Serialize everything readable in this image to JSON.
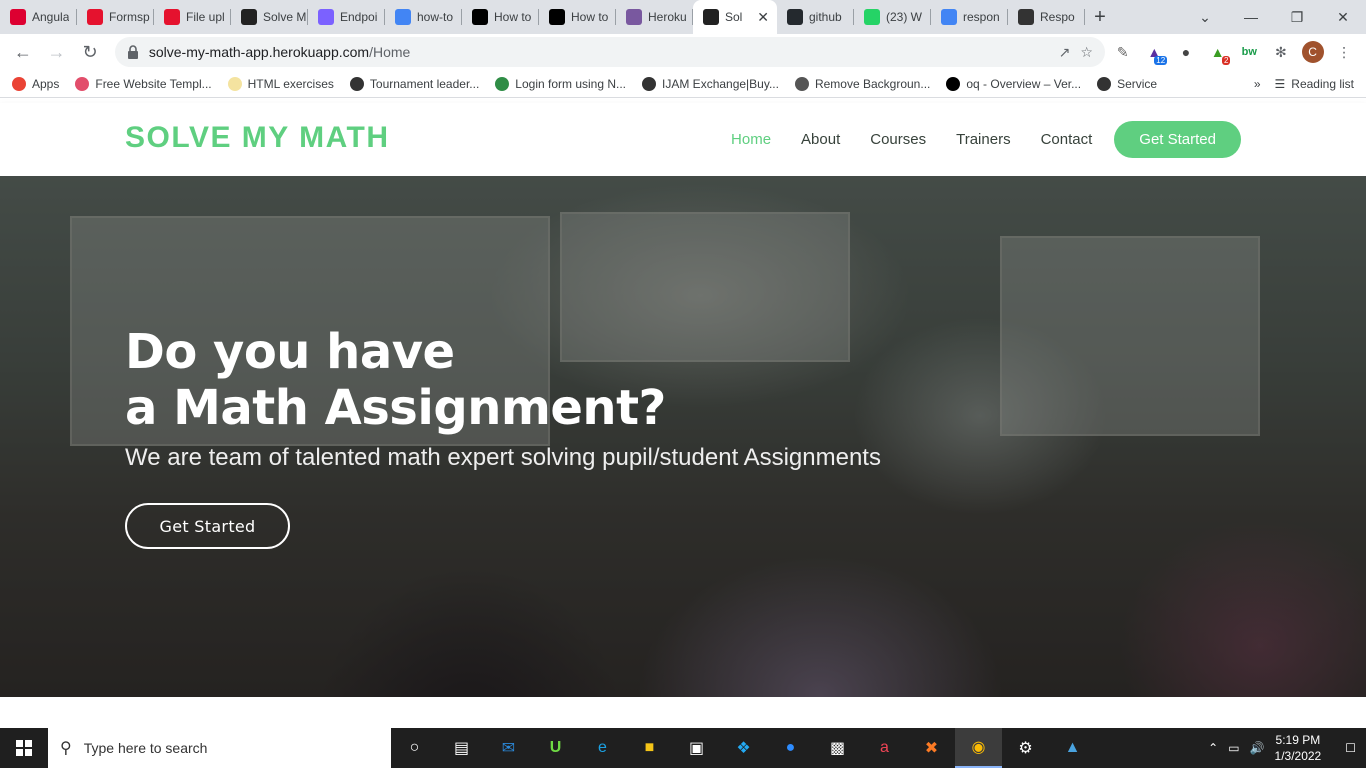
{
  "browser": {
    "tabs": [
      {
        "label": "Angula",
        "icon": "angular-icon",
        "color": "#dd0031"
      },
      {
        "label": "Formsp",
        "icon": "formspree-icon",
        "color": "#e5122e"
      },
      {
        "label": "File upl",
        "icon": "formspree-icon",
        "color": "#e5122e"
      },
      {
        "label": "Solve M",
        "icon": "angular-dark-icon",
        "color": "#222222"
      },
      {
        "label": "Endpoi",
        "icon": "endpoint-icon",
        "color": "#7b61ff"
      },
      {
        "label": "how-to",
        "icon": "google-icon",
        "color": "#4285f4"
      },
      {
        "label": "How to",
        "icon": "medium-icon",
        "color": "#000000"
      },
      {
        "label": "How to",
        "icon": "medium-icon",
        "color": "#000000"
      },
      {
        "label": "Heroku",
        "icon": "heroku-icon",
        "color": "#79589f"
      },
      {
        "label": "Sol",
        "icon": "angular-dark-icon",
        "color": "#222222",
        "active": true
      },
      {
        "label": "github",
        "icon": "github-icon",
        "color": "#24292e"
      },
      {
        "label": "(23) W",
        "icon": "whatsapp-icon",
        "color": "#25d366"
      },
      {
        "label": "respon",
        "icon": "google-icon",
        "color": "#4285f4"
      },
      {
        "label": "Respo",
        "icon": "responsive-icon",
        "color": "#333333"
      }
    ],
    "url_host": "solve-my-math-app.herokuapp.com",
    "url_path": "/Home",
    "profile_initial": "C",
    "ext_badge_1": "12",
    "ext_badge_2": "2",
    "ext_bw": "bw",
    "bookmarks": [
      {
        "label": "Apps",
        "color": "#ea4335"
      },
      {
        "label": "Free Website Templ...",
        "color": "#e24e6b"
      },
      {
        "label": "HTML exercises",
        "color": "#f4e3a0"
      },
      {
        "label": "Tournament leader...",
        "color": "#333333"
      },
      {
        "label": "Login form using N...",
        "color": "#2f8d46"
      },
      {
        "label": "IJAM Exchange|Buy...",
        "color": "#333333"
      },
      {
        "label": "Remove Backgroun...",
        "color": "#555555"
      },
      {
        "label": "oq - Overview – Ver...",
        "color": "#000000"
      },
      {
        "label": "Service",
        "color": "#333333"
      }
    ],
    "reading_list": "Reading list"
  },
  "site": {
    "logo": "SOLVE MY MATH",
    "nav": [
      "Home",
      "About",
      "Courses",
      "Trainers",
      "Contact"
    ],
    "nav_cta": "Get Started",
    "accent_color": "#5fcf80"
  },
  "hero": {
    "title_line1": "Do you have",
    "title_line2": "a Math Assignment?",
    "subtitle": "We are team of talented math expert solving pupil/student Assignments",
    "cta": "Get Started"
  },
  "taskbar": {
    "search_placeholder": "Type here to search",
    "time": "5:19 PM",
    "date": "1/3/2022"
  }
}
